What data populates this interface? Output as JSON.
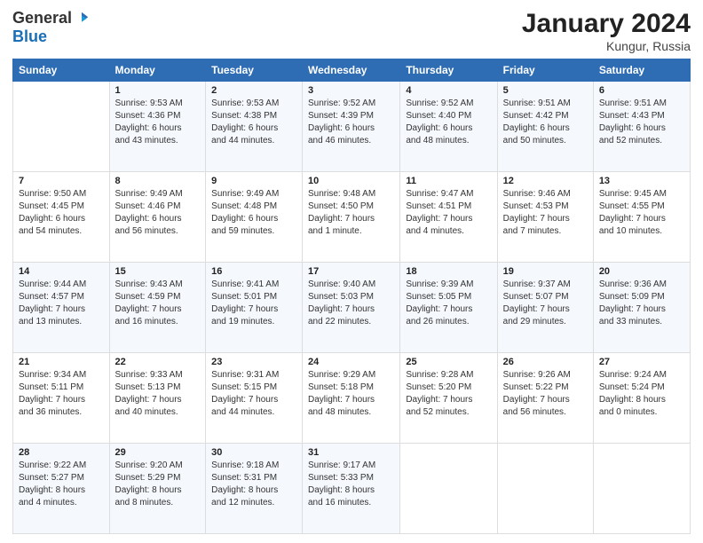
{
  "header": {
    "logo_general": "General",
    "logo_blue": "Blue",
    "month_title": "January 2024",
    "location": "Kungur, Russia"
  },
  "columns": [
    "Sunday",
    "Monday",
    "Tuesday",
    "Wednesday",
    "Thursday",
    "Friday",
    "Saturday"
  ],
  "weeks": [
    [
      {
        "day": "",
        "info": ""
      },
      {
        "day": "1",
        "info": "Sunrise: 9:53 AM\nSunset: 4:36 PM\nDaylight: 6 hours\nand 43 minutes."
      },
      {
        "day": "2",
        "info": "Sunrise: 9:53 AM\nSunset: 4:38 PM\nDaylight: 6 hours\nand 44 minutes."
      },
      {
        "day": "3",
        "info": "Sunrise: 9:52 AM\nSunset: 4:39 PM\nDaylight: 6 hours\nand 46 minutes."
      },
      {
        "day": "4",
        "info": "Sunrise: 9:52 AM\nSunset: 4:40 PM\nDaylight: 6 hours\nand 48 minutes."
      },
      {
        "day": "5",
        "info": "Sunrise: 9:51 AM\nSunset: 4:42 PM\nDaylight: 6 hours\nand 50 minutes."
      },
      {
        "day": "6",
        "info": "Sunrise: 9:51 AM\nSunset: 4:43 PM\nDaylight: 6 hours\nand 52 minutes."
      }
    ],
    [
      {
        "day": "7",
        "info": "Sunrise: 9:50 AM\nSunset: 4:45 PM\nDaylight: 6 hours\nand 54 minutes."
      },
      {
        "day": "8",
        "info": "Sunrise: 9:49 AM\nSunset: 4:46 PM\nDaylight: 6 hours\nand 56 minutes."
      },
      {
        "day": "9",
        "info": "Sunrise: 9:49 AM\nSunset: 4:48 PM\nDaylight: 6 hours\nand 59 minutes."
      },
      {
        "day": "10",
        "info": "Sunrise: 9:48 AM\nSunset: 4:50 PM\nDaylight: 7 hours\nand 1 minute."
      },
      {
        "day": "11",
        "info": "Sunrise: 9:47 AM\nSunset: 4:51 PM\nDaylight: 7 hours\nand 4 minutes."
      },
      {
        "day": "12",
        "info": "Sunrise: 9:46 AM\nSunset: 4:53 PM\nDaylight: 7 hours\nand 7 minutes."
      },
      {
        "day": "13",
        "info": "Sunrise: 9:45 AM\nSunset: 4:55 PM\nDaylight: 7 hours\nand 10 minutes."
      }
    ],
    [
      {
        "day": "14",
        "info": "Sunrise: 9:44 AM\nSunset: 4:57 PM\nDaylight: 7 hours\nand 13 minutes."
      },
      {
        "day": "15",
        "info": "Sunrise: 9:43 AM\nSunset: 4:59 PM\nDaylight: 7 hours\nand 16 minutes."
      },
      {
        "day": "16",
        "info": "Sunrise: 9:41 AM\nSunset: 5:01 PM\nDaylight: 7 hours\nand 19 minutes."
      },
      {
        "day": "17",
        "info": "Sunrise: 9:40 AM\nSunset: 5:03 PM\nDaylight: 7 hours\nand 22 minutes."
      },
      {
        "day": "18",
        "info": "Sunrise: 9:39 AM\nSunset: 5:05 PM\nDaylight: 7 hours\nand 26 minutes."
      },
      {
        "day": "19",
        "info": "Sunrise: 9:37 AM\nSunset: 5:07 PM\nDaylight: 7 hours\nand 29 minutes."
      },
      {
        "day": "20",
        "info": "Sunrise: 9:36 AM\nSunset: 5:09 PM\nDaylight: 7 hours\nand 33 minutes."
      }
    ],
    [
      {
        "day": "21",
        "info": "Sunrise: 9:34 AM\nSunset: 5:11 PM\nDaylight: 7 hours\nand 36 minutes."
      },
      {
        "day": "22",
        "info": "Sunrise: 9:33 AM\nSunset: 5:13 PM\nDaylight: 7 hours\nand 40 minutes."
      },
      {
        "day": "23",
        "info": "Sunrise: 9:31 AM\nSunset: 5:15 PM\nDaylight: 7 hours\nand 44 minutes."
      },
      {
        "day": "24",
        "info": "Sunrise: 9:29 AM\nSunset: 5:18 PM\nDaylight: 7 hours\nand 48 minutes."
      },
      {
        "day": "25",
        "info": "Sunrise: 9:28 AM\nSunset: 5:20 PM\nDaylight: 7 hours\nand 52 minutes."
      },
      {
        "day": "26",
        "info": "Sunrise: 9:26 AM\nSunset: 5:22 PM\nDaylight: 7 hours\nand 56 minutes."
      },
      {
        "day": "27",
        "info": "Sunrise: 9:24 AM\nSunset: 5:24 PM\nDaylight: 8 hours\nand 0 minutes."
      }
    ],
    [
      {
        "day": "28",
        "info": "Sunrise: 9:22 AM\nSunset: 5:27 PM\nDaylight: 8 hours\nand 4 minutes."
      },
      {
        "day": "29",
        "info": "Sunrise: 9:20 AM\nSunset: 5:29 PM\nDaylight: 8 hours\nand 8 minutes."
      },
      {
        "day": "30",
        "info": "Sunrise: 9:18 AM\nSunset: 5:31 PM\nDaylight: 8 hours\nand 12 minutes."
      },
      {
        "day": "31",
        "info": "Sunrise: 9:17 AM\nSunset: 5:33 PM\nDaylight: 8 hours\nand 16 minutes."
      },
      {
        "day": "",
        "info": ""
      },
      {
        "day": "",
        "info": ""
      },
      {
        "day": "",
        "info": ""
      }
    ]
  ]
}
